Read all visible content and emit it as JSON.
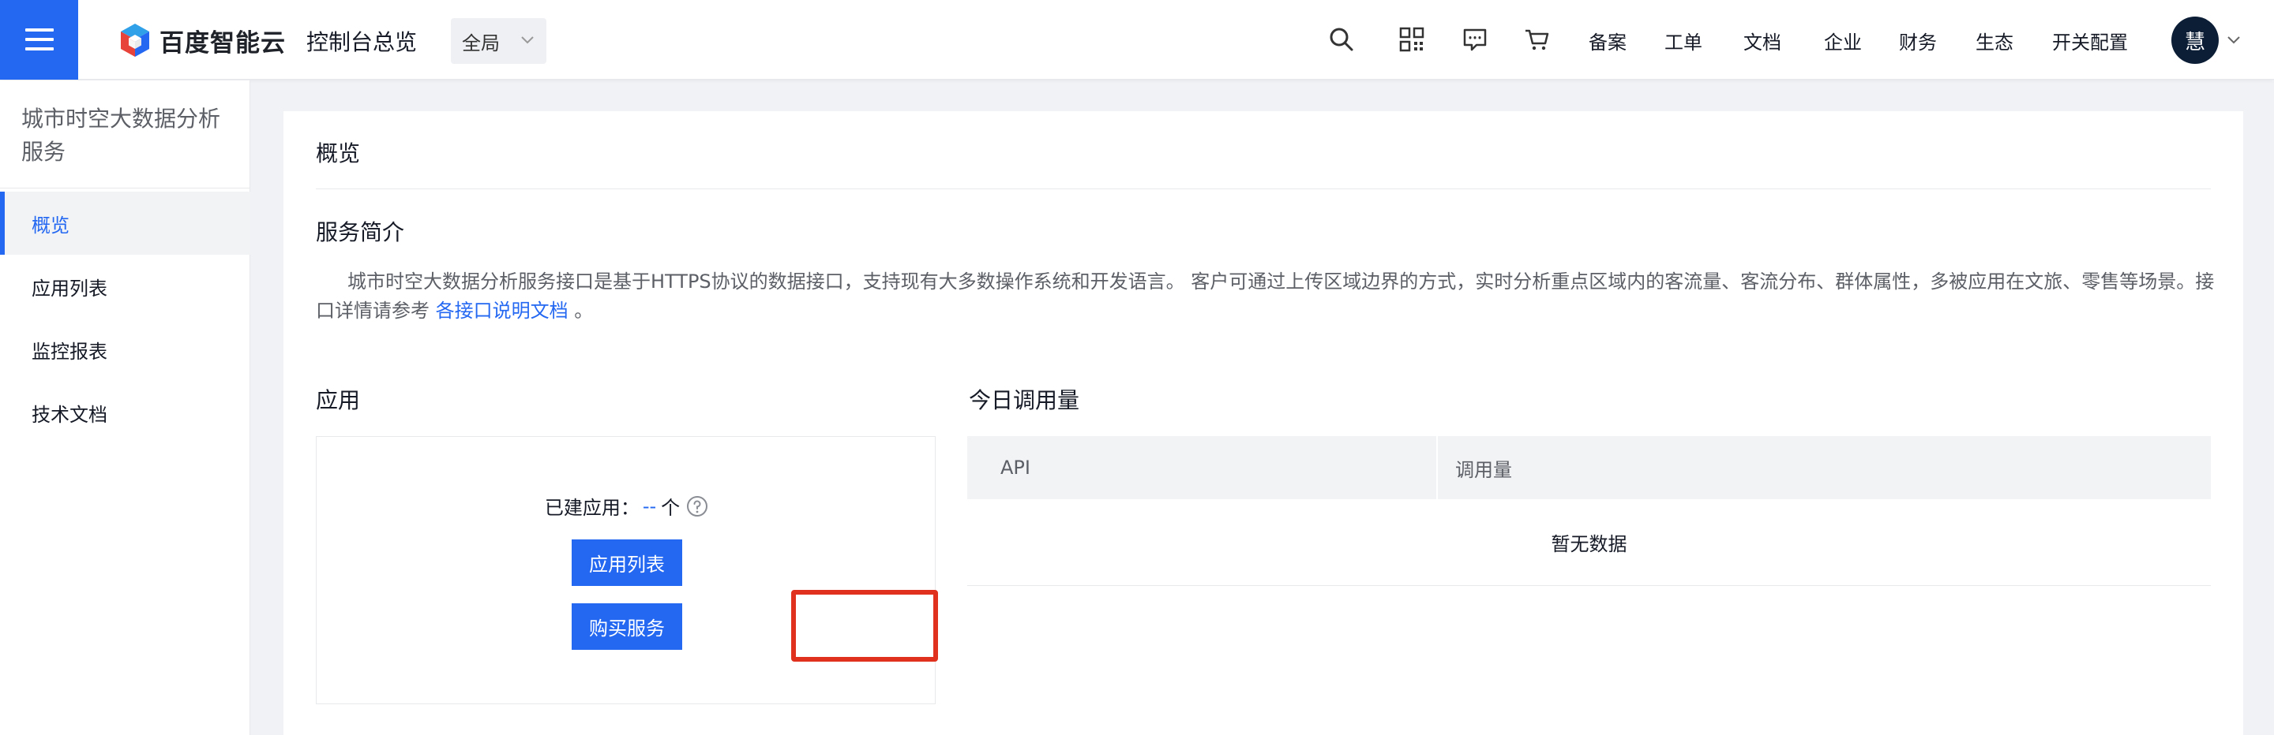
{
  "header": {
    "logo_text": "百度智能云",
    "console_title": "控制台总览",
    "region": "全局",
    "nav_links": [
      "备案",
      "工单",
      "文档",
      "企业",
      "财务",
      "生态",
      "开关配置"
    ],
    "avatar_text": "慧",
    "icons": [
      "menu-icon",
      "search-icon",
      "qrcode-icon",
      "message-icon",
      "cart-icon",
      "chevron-down-icon"
    ]
  },
  "sidebar": {
    "title": "城市时空大数据分析服务",
    "items": [
      {
        "label": "概览",
        "active": true
      },
      {
        "label": "应用列表",
        "active": false
      },
      {
        "label": "监控报表",
        "active": false
      },
      {
        "label": "技术文档",
        "active": false
      }
    ]
  },
  "main": {
    "page_title": "概览",
    "intro": {
      "title": "服务简介",
      "text": "城市时空大数据分析服务接口是基于HTTPS协议的数据接口，支持现有大多数操作系统和开发语言。 客户可通过上传区域边界的方式，实时分析重点区域内的客流量、客流分布、群体属性，多被应用在文旅、零售等场景。接口详情请参考 ",
      "link": "各接口说明文档",
      "end": " 。"
    },
    "app": {
      "title": "应用",
      "count_label": "已建应用：",
      "count_value": "--",
      "count_unit": "个",
      "list_button": "应用列表",
      "buy_button": "购买服务"
    },
    "usage": {
      "title": "今日调用量",
      "columns": [
        "API",
        "调用量"
      ],
      "empty": "暂无数据"
    }
  },
  "colors": {
    "accent": "#2468f2",
    "highlight": "#e0301e",
    "avatar_bg": "#0c1e36"
  }
}
